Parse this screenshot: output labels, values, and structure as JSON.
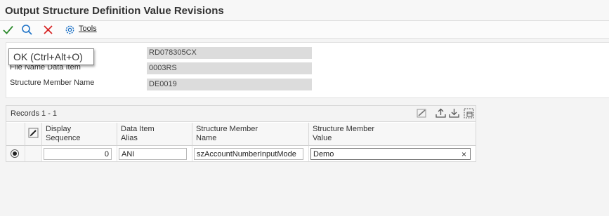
{
  "window": {
    "title": "Output Structure Definition Value Revisions"
  },
  "toolbar": {
    "tools_label": "Tools"
  },
  "tooltip": {
    "text": "OK (Ctrl+Alt+O)"
  },
  "form": {
    "fields": [
      {
        "label": "",
        "value": "RD078305CX"
      },
      {
        "label": "File Name Data Item",
        "value": "0003RS"
      },
      {
        "label": "Structure Member Name",
        "value": "DE0019"
      }
    ]
  },
  "grid": {
    "records": "Records 1 - 1",
    "columns": [
      {
        "line1": "Display",
        "line2": "Sequence"
      },
      {
        "line1": "Data Item",
        "line2": "Alias"
      },
      {
        "line1": "Structure Member",
        "line2": "Name"
      },
      {
        "line1": "Structure Member",
        "line2": "Value"
      }
    ],
    "rows": [
      {
        "display_sequence": "0",
        "data_item_alias": "ANI",
        "structure_member_name": "szAccountNumberInputMode",
        "structure_member_value": "Demo"
      }
    ]
  },
  "colors": {
    "ok_green": "#2e8b2e",
    "find_blue": "#1f73c7",
    "cancel_red": "#d62020",
    "tools_blue": "#1f73c7"
  }
}
